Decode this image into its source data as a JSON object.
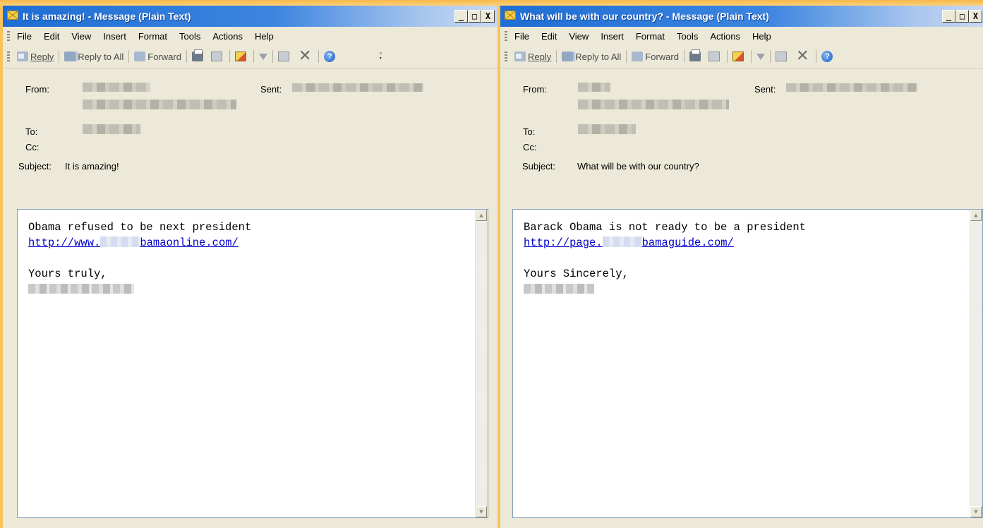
{
  "left": {
    "title": "It is amazing! - Message (Plain Text)",
    "menu": [
      "File",
      "Edit",
      "View",
      "Insert",
      "Format",
      "Tools",
      "Actions",
      "Help"
    ],
    "toolbar": {
      "reply": "Reply",
      "reply_all": "Reply to All",
      "forward": "Forward"
    },
    "header": {
      "from_label": "From:",
      "sent_label": "Sent:",
      "to_label": "To:",
      "cc_label": "Cc:",
      "subject_label": "Subject:",
      "subject": "It is amazing!"
    },
    "body": {
      "line1": "Obama refused to be next president",
      "link_prefix": "http://www.",
      "link_suffix": "bamaonline.com/",
      "closing": "Yours truly,"
    }
  },
  "right": {
    "title": "What will be with our country? - Message (Plain Text)",
    "menu": [
      "File",
      "Edit",
      "View",
      "Insert",
      "Format",
      "Tools",
      "Actions",
      "Help"
    ],
    "toolbar": {
      "reply": "Reply",
      "reply_all": "Reply to All",
      "forward": "Forward"
    },
    "header": {
      "from_label": "From:",
      "sent_label": "Sent:",
      "to_label": "To:",
      "cc_label": "Cc:",
      "subject_label": "Subject:",
      "subject": "What will be with our country?"
    },
    "body": {
      "line1": "Barack Obama is not ready to be a president",
      "link_prefix": "http://page.",
      "link_suffix": "bamaguide.com/",
      "closing": "Yours Sincerely,"
    }
  },
  "window_buttons": {
    "minimize": "_",
    "maximize": "□",
    "close": "X"
  },
  "colors": {
    "titlebar": "#2a76d8",
    "link": "#0000cc",
    "background": "#fac35a",
    "chrome": "#ece9d8"
  }
}
